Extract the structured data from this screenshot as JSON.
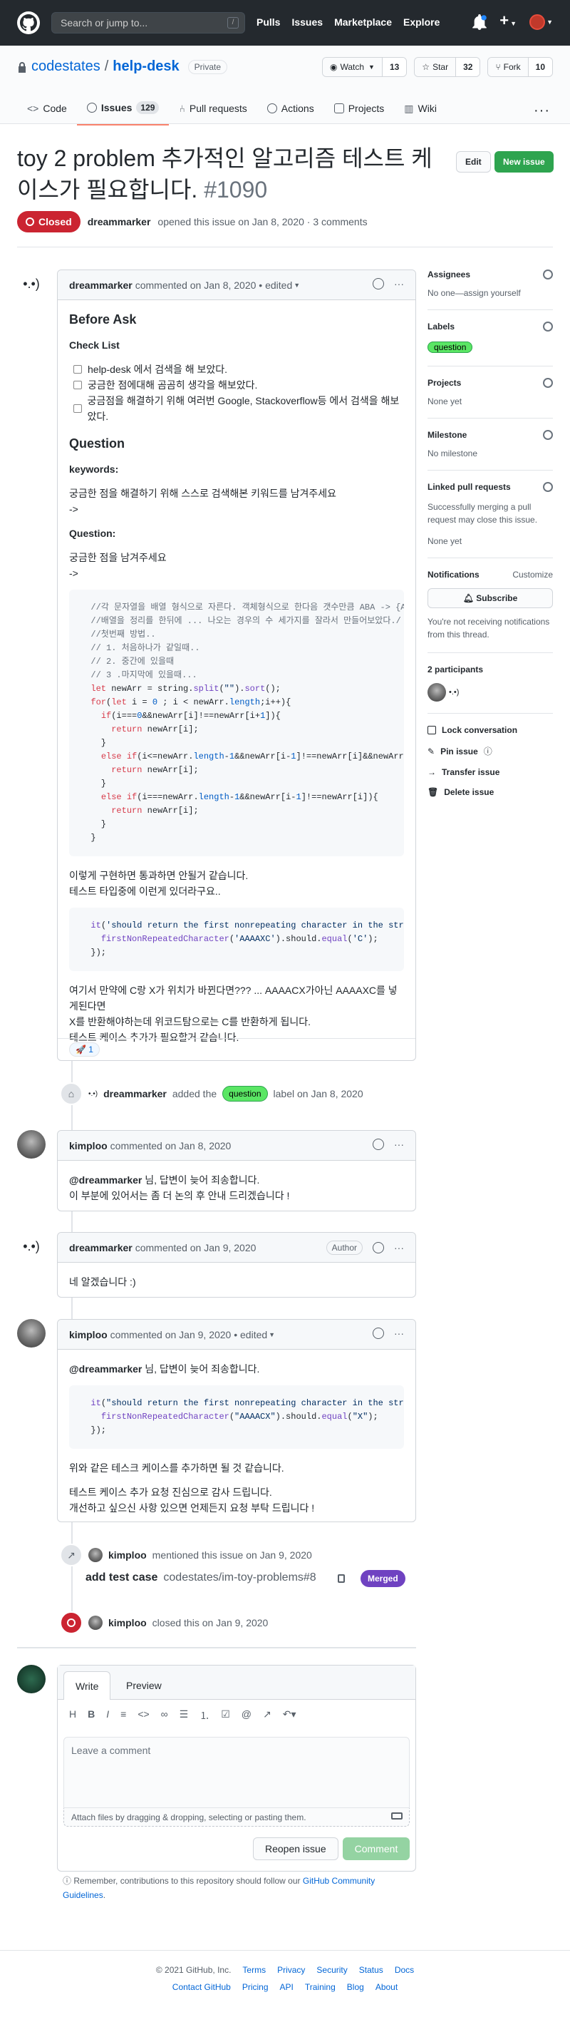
{
  "header": {
    "search_placeholder": "Search or jump to...",
    "search_key": "/",
    "nav": [
      "Pulls",
      "Issues",
      "Marketplace",
      "Explore"
    ]
  },
  "repo": {
    "owner": "codestates",
    "name": "help-desk",
    "visibility": "Private",
    "watch_label": "Watch",
    "watch_count": "13",
    "star_label": "Star",
    "star_count": "32",
    "fork_label": "Fork",
    "fork_count": "10",
    "tabs": [
      {
        "label": "Code"
      },
      {
        "label": "Issues",
        "count": "129"
      },
      {
        "label": "Pull requests"
      },
      {
        "label": "Actions"
      },
      {
        "label": "Projects"
      },
      {
        "label": "Wiki"
      }
    ],
    "more": "···"
  },
  "issue": {
    "title": "toy 2 problem 추가적인 알고리즘 테스트 케이스가 필요합니다.",
    "number": "#1090",
    "edit_label": "Edit",
    "new_issue_label": "New issue",
    "state": "Closed",
    "author": "dreammarker",
    "meta": "opened this issue on Jan 8, 2020 · 3 comments"
  },
  "comments": [
    {
      "author": "dreammarker",
      "meta": "commented on Jan 8, 2020 • edited",
      "h_before": "Before Ask",
      "h_check": "Check List",
      "checklist": [
        "help-desk 에서 검색을 해 보았다.",
        "궁금한 점에대해 곰곰히 생각을 해보았다.",
        "궁금점을 해결하기 위해 여러번 Google, Stackoverflow등 에서 검색을 해보았다."
      ],
      "h_question": "Question",
      "h_keywords": "keywords:",
      "keywords_text": "궁금한 점을 해결하기 위해 스스로 검색해본 키워드를 남겨주세요",
      "arrow1": "->",
      "h_question2": "Question:",
      "question_text": "궁금한 점을 남겨주세요",
      "arrow2": "->",
      "para1a": "이렇게 구현하면 통과하면 안될거 같습니다.",
      "para1b": "테스트 타입중에 이런게 있더라구요..",
      "para2a": "여기서 만약에 C랑 X가 위치가 바뀐다면??? ... AAAACX가아닌 AAAAXC를 넣게된다면",
      "para2b": "X를 반환해야하는데 위코드탐으로는 C를 반환하게 됩니다.",
      "para2c": "테스트 케이스 추가가 필요할거 같습니다.",
      "reaction": "🚀 1"
    },
    {
      "author": "kimploo",
      "meta": "commented on Jan 8, 2020",
      "mention": "@dreammarker",
      "line1": " 님, 답변이 늦어 죄송합니다.",
      "line2": "이 부분에 있어서는 좀 더 논의 후 안내 드리겠습니다 !"
    },
    {
      "author": "dreammarker",
      "meta": "commented on Jan 9, 2020",
      "badge": "Author",
      "line1": "네 알겠습니다 :)"
    },
    {
      "author": "kimploo",
      "meta": "commented on Jan 9, 2020 • edited",
      "mention": "@dreammarker",
      "line1": " 님, 답변이 늦어 죄송합니다.",
      "line2": "위와 같은 테스크 케이스를 추가하면 될 것 같습니다.",
      "line3": "테스트 케이스 추가 요청 진심으로 감사 드립니다.",
      "line4": "개선하고 싶으신 사항 있으면 언제든지 요청 부탁 드립니다 !"
    }
  ],
  "events": {
    "label_actor": "dreammarker",
    "label_pre": "added the",
    "label_name": "question",
    "label_post": "label on Jan 8, 2020",
    "mention_actor": "kimploo",
    "mention_text": "mentioned this issue on Jan 9, 2020",
    "xref_title": "add test case",
    "xref_repo": "codestates/im-toy-problems#8",
    "xref_state": "Merged",
    "closed_actor": "kimploo",
    "closed_text": "closed this on Jan 9, 2020"
  },
  "sidebar": {
    "assignees_h": "Assignees",
    "assignees_v": "No one—assign yourself",
    "labels_h": "Labels",
    "label": "question",
    "projects_h": "Projects",
    "projects_v": "None yet",
    "milestone_h": "Milestone",
    "milestone_v": "No milestone",
    "linked_h": "Linked pull requests",
    "linked_desc": "Successfully merging a pull request may close this issue.",
    "linked_v": "None yet",
    "notif_h": "Notifications",
    "notif_customize": "Customize",
    "subscribe": "Subscribe",
    "notif_desc": "You're not receiving notifications from this thread.",
    "participants_h": "2 participants",
    "actions": [
      "Lock conversation",
      "Pin issue",
      "Transfer issue",
      "Delete issue"
    ]
  },
  "composer": {
    "tab_write": "Write",
    "tab_preview": "Preview",
    "placeholder": "Leave a comment",
    "attach": "Attach files by dragging & dropping, selecting or pasting them.",
    "reopen": "Reopen issue",
    "comment": "Comment",
    "remember_pre": "Remember, contributions to this repository should follow our",
    "remember_link": "GitHub Community Guidelines",
    "remember_post": "."
  },
  "footer": {
    "copyright": "© 2021 GitHub, Inc.",
    "row1": [
      "Terms",
      "Privacy",
      "Security",
      "Status",
      "Docs"
    ],
    "row2": [
      "Contact GitHub",
      "Pricing",
      "API",
      "Training",
      "Blog",
      "About"
    ]
  },
  "colors": {
    "closed": "#cb2431",
    "merged": "#6f42c1",
    "new_issue": "#2ea44f",
    "label_question": "#5ae664"
  }
}
